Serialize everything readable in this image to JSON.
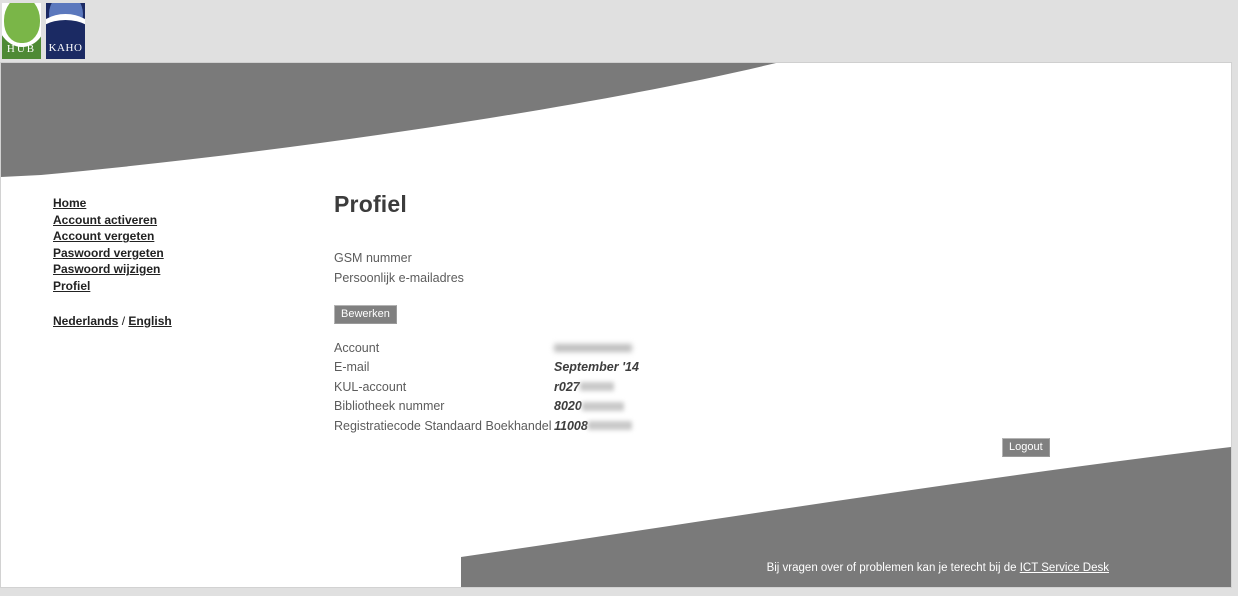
{
  "brand": {
    "logos": [
      {
        "name": "hub-logo",
        "text": "HUB"
      },
      {
        "name": "kaho-logo",
        "text": "KAHO"
      }
    ]
  },
  "sidebar": {
    "items": [
      {
        "label": "Home"
      },
      {
        "label": "Account activeren"
      },
      {
        "label": "Account vergeten"
      },
      {
        "label": "Paswoord vergeten"
      },
      {
        "label": "Paswoord wijzigen"
      },
      {
        "label": "Profiel"
      }
    ],
    "language": {
      "dutch": "Nederlands",
      "separator": "/",
      "english": "English"
    }
  },
  "main": {
    "title": "Profiel",
    "fields": [
      {
        "label": "GSM nummer"
      },
      {
        "label": "Persoonlijk e-mailadres"
      }
    ],
    "edit_button": "Bewerken",
    "details": [
      {
        "label": "Account",
        "value": "",
        "redacted": true,
        "redacted_width": 78
      },
      {
        "label": "E-mail",
        "value": "September '14",
        "redacted": false,
        "redacted_width": 0
      },
      {
        "label": "KUL-account",
        "value": "r027",
        "redacted": true,
        "redacted_width": 34
      },
      {
        "label": "Bibliotheek nummer",
        "value": "8020",
        "redacted": true,
        "redacted_width": 42
      },
      {
        "label": "Registratiecode Standaard Boekhandel",
        "value": "11008",
        "redacted": true,
        "redacted_width": 44
      }
    ],
    "logout_button": "Logout"
  },
  "footer": {
    "text": "Bij vragen over of problemen kan je terecht bij de",
    "link": "ICT Service Desk"
  },
  "colors": {
    "banner_grey": "#7a7a7a",
    "page_background": "#e0e0e0",
    "canvas": "#ffffff",
    "hub_green": "#4e8a35",
    "kaho_navy": "#1b2a63",
    "button_grey": "#808080"
  }
}
